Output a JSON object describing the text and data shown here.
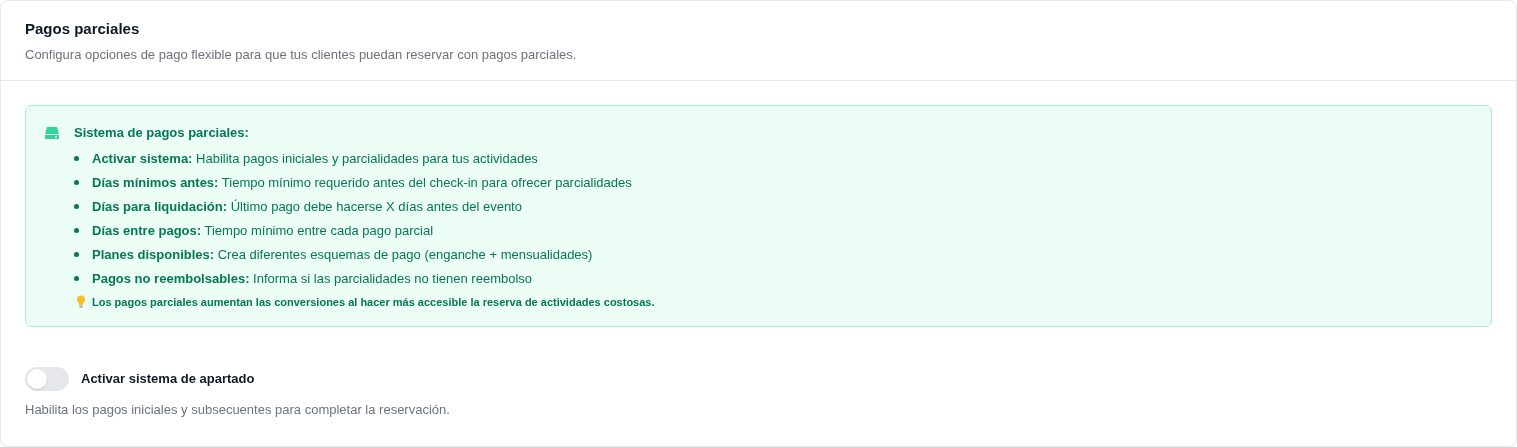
{
  "header": {
    "title": "Pagos parciales",
    "subtitle": "Configura opciones de pago flexible para que tus clientes puedan reservar con pagos parciales."
  },
  "info": {
    "title": "Sistema de pagos parciales:",
    "items": [
      "**Activar sistema:** Habilita pagos iniciales y parcialidades para tus actividades",
      "**Días mínimos antes:** Tiempo mínimo requerido antes del check-in para ofrecer parcialidades",
      "**Días para liquidación:** Último pago debe hacerse X días antes del evento",
      "**Días entre pagos:** Tiempo mínimo entre cada pago parcial",
      "**Planes disponibles:** Crea diferentes esquemas de pago (enganche + mensualidades)",
      "**Pagos no reembolsables:** Informa si las parcialidades no tienen reembolso"
    ],
    "tip": "Los pagos parciales aumentan las conversiones al hacer más accesible la reserva de actividades costosas."
  },
  "toggle": {
    "label": "Activar sistema de apartado",
    "on": false,
    "description": "Habilita los pagos iniciales y subsecuentes para completar la reservación."
  }
}
